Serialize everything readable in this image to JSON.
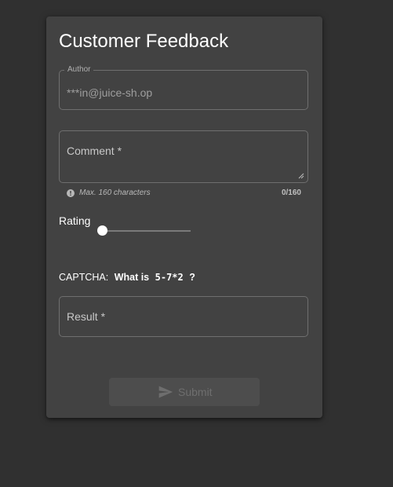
{
  "form": {
    "title": "Customer Feedback",
    "author": {
      "label": "Author",
      "value": "***in@juice-sh.op"
    },
    "comment": {
      "label": "Comment *",
      "value": "",
      "hint": "Max. 160 characters",
      "counter": "0/160",
      "hint_icon": "info-icon"
    },
    "rating": {
      "label": "Rating",
      "value": 0
    },
    "captcha": {
      "label": "CAPTCHA:",
      "question": "What is",
      "expression": "5-7*2",
      "question_mark": "?"
    },
    "result": {
      "label": "Result *",
      "value": ""
    },
    "submit": {
      "label": "Submit",
      "icon": "send-icon",
      "disabled": true
    }
  },
  "colors": {
    "page_background": "#303030",
    "card_background": "#424242",
    "text_primary": "#ffffff",
    "text_secondary": "#9e9e9e",
    "button_disabled_background": "#4d4d4d",
    "button_disabled_text": "#6e6e6e"
  }
}
